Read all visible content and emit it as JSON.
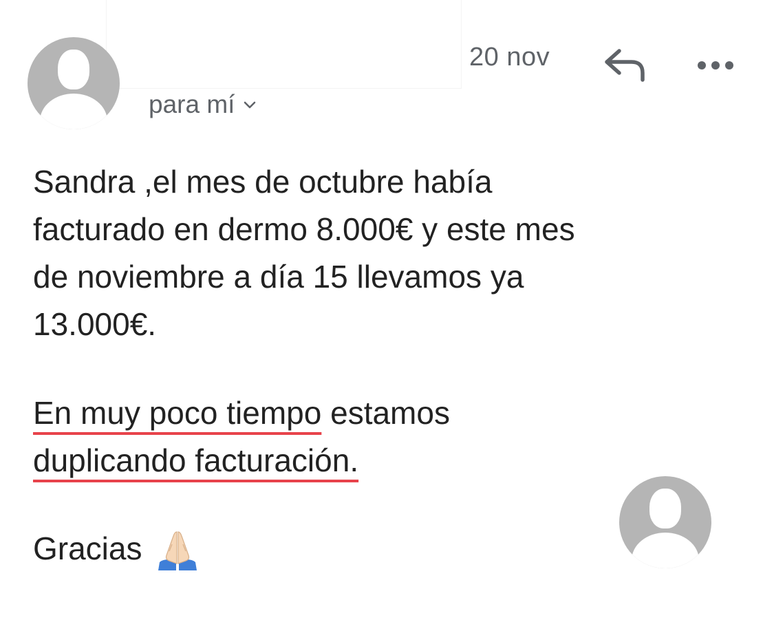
{
  "message": {
    "sender_name": "",
    "date": "20 nov",
    "recipient_label": "para mí",
    "reply_icon": "reply-icon",
    "more_icon": "more-horizontal-icon",
    "chevron_icon": "chevron-down-icon",
    "body": {
      "paragraph1": [
        "Sandra ,el mes de octubre había",
        "facturado en dermo 8.000€ y este mes",
        "de noviembre a día 15 llevamos ya",
        "13.000€."
      ],
      "paragraph2": {
        "line1_underlined": "En muy poco tiempo",
        "line1_rest": " estamos",
        "line2_underlined": "duplicando facturación."
      },
      "signoff": "Gracias",
      "signoff_icon": "praying-hands-icon"
    }
  },
  "colors": {
    "avatar": "#b5b5b5",
    "secondary_text": "#5f6368",
    "body_text": "#222222",
    "underline": "#e8434b"
  }
}
